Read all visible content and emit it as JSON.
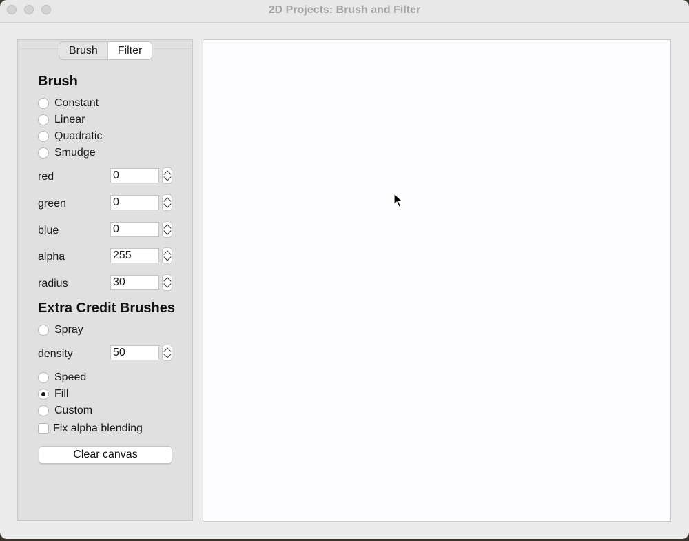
{
  "window": {
    "title": "2D Projects: Brush and Filter"
  },
  "tabs": [
    {
      "label": "Brush"
    },
    {
      "label": "Filter"
    }
  ],
  "brush": {
    "heading": "Brush",
    "types": [
      {
        "label": "Constant",
        "checked": false
      },
      {
        "label": "Linear",
        "checked": false
      },
      {
        "label": "Quadratic",
        "checked": false
      },
      {
        "label": "Smudge",
        "checked": false
      }
    ],
    "fields": {
      "red": {
        "label": "red",
        "value": "0"
      },
      "green": {
        "label": "green",
        "value": "0"
      },
      "blue": {
        "label": "blue",
        "value": "0"
      },
      "alpha": {
        "label": "alpha",
        "value": "255"
      },
      "radius": {
        "label": "radius",
        "value": "30"
      }
    }
  },
  "extra": {
    "heading": "Extra Credit Brushes",
    "spray": {
      "label": "Spray",
      "checked": false
    },
    "density": {
      "label": "density",
      "value": "50"
    },
    "speed": {
      "label": "Speed",
      "checked": false
    },
    "fill": {
      "label": "Fill",
      "checked": true
    },
    "custom": {
      "label": "Custom",
      "checked": false
    },
    "fix_alpha": {
      "label": "Fix alpha blending",
      "checked": false
    }
  },
  "clear_button": {
    "label": "Clear canvas"
  },
  "icons": {
    "cursor": "arrow-cursor-icon"
  }
}
